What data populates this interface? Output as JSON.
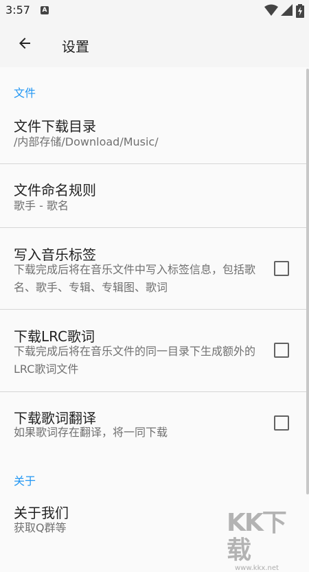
{
  "status_bar": {
    "time": "3:57",
    "notification_label": "A"
  },
  "app_bar": {
    "title": "设置"
  },
  "sections": {
    "file": {
      "header": "文件",
      "download_dir": {
        "title": "文件下载目录",
        "summary": "/内部存储/Download/Music/"
      },
      "naming_rule": {
        "title": "文件命名规则",
        "summary": "歌手 - 歌名"
      },
      "write_tags": {
        "title": "写入音乐标签",
        "summary": "下载完成后将在音乐文件中写入标签信息，包括歌名、歌手、专辑、专辑图、歌词",
        "checked": false
      },
      "download_lrc": {
        "title": "下载LRC歌词",
        "summary": "下载完成后将在音乐文件的同一目录下生成额外的LRC歌词文件",
        "checked": false
      },
      "download_translation": {
        "title": "下载歌词翻译",
        "summary": "如果歌词存在翻译，将一同下载",
        "checked": false
      }
    },
    "about": {
      "header": "关于",
      "about_us": {
        "title": "关于我们",
        "summary": "获取Q群等"
      }
    }
  },
  "watermark": {
    "logo": "KK下载",
    "url": "www.kkx.net"
  },
  "colors": {
    "accent": "#2196f3",
    "background": "#fafafa",
    "divider": "#d6d6d6"
  }
}
